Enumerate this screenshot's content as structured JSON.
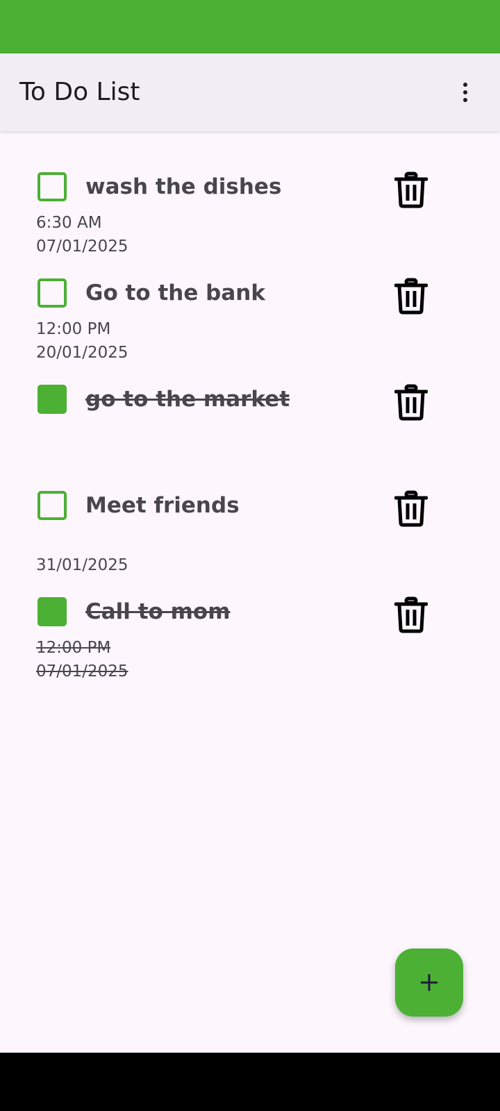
{
  "app": {
    "title": "To Do List",
    "accent_color": "#4cb034"
  },
  "toolbar": {
    "overflow_icon": "more-vert-icon"
  },
  "todos": [
    {
      "title": "wash the dishes",
      "time": "6:30 AM",
      "date": "07/01/2025",
      "checked": false
    },
    {
      "title": "Go to the bank",
      "time": "12:00 PM",
      "date": "20/01/2025",
      "checked": false
    },
    {
      "title": "go to the market",
      "time": "",
      "date": "",
      "checked": true
    },
    {
      "title": "Meet friends",
      "time": "",
      "date": "31/01/2025",
      "checked": false
    },
    {
      "title": "Call to mom",
      "time": "12:00 PM",
      "date": "07/01/2025",
      "checked": true
    }
  ],
  "delete_icon": "trash-icon",
  "fab": {
    "icon": "plus-icon"
  }
}
